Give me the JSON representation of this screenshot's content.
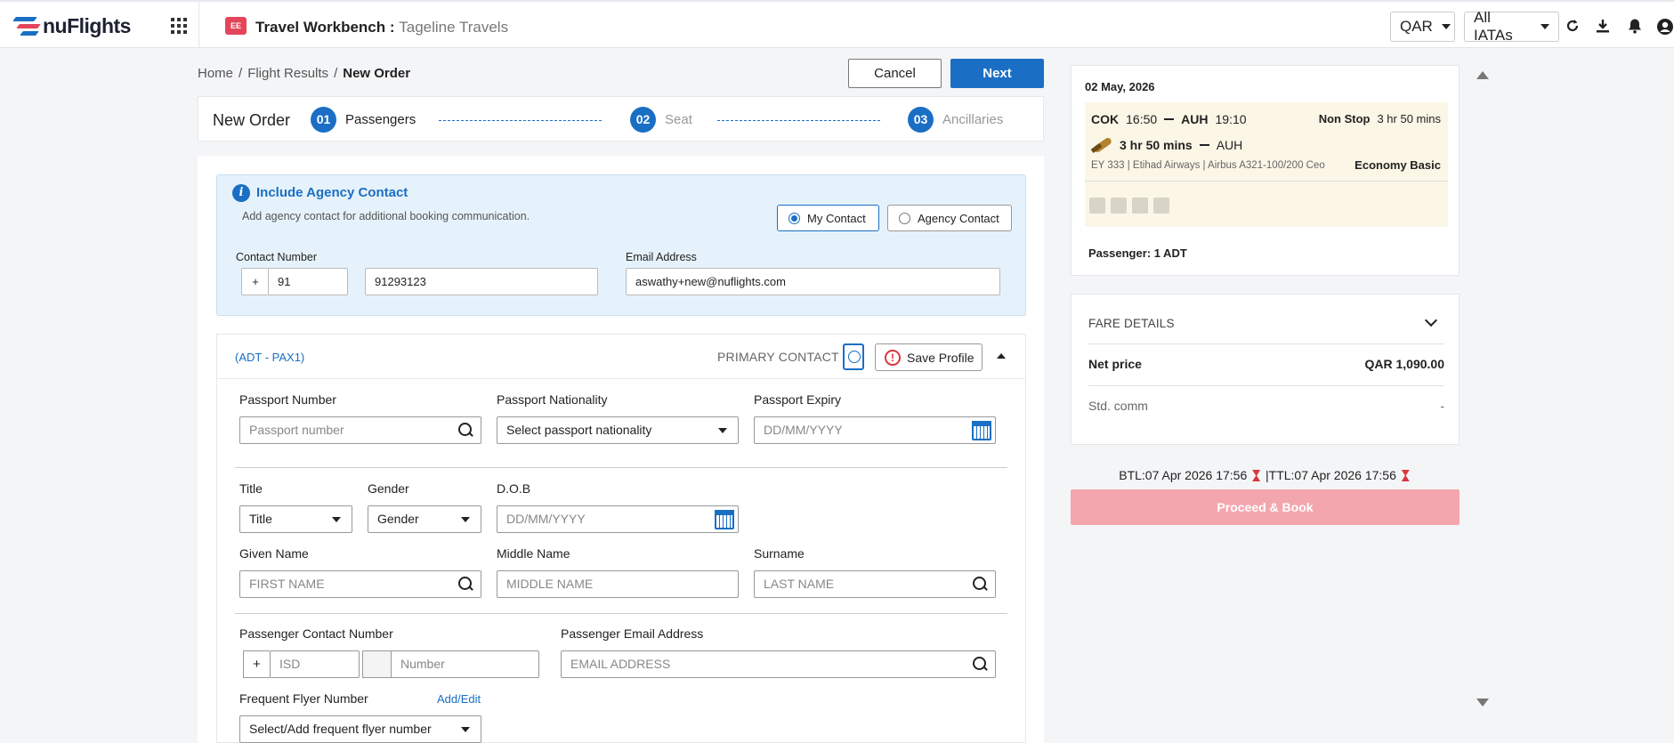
{
  "header": {
    "logo_text": "nuFlights",
    "workbench_icon": "EE",
    "workbench_title": "Travel Workbench : ",
    "agency_name": "Tageline Travels",
    "currency": "QAR",
    "iata": "All IATAs",
    "icons": [
      "apps-grid-icon",
      "refresh-icon",
      "download-icon",
      "bell-icon",
      "user-icon"
    ]
  },
  "breadcrumb": {
    "home": "Home",
    "sep": "/",
    "flight_results": "Flight Results",
    "current": "New Order"
  },
  "actions": {
    "cancel": "Cancel",
    "next": "Next"
  },
  "stepper": {
    "label": "New Order",
    "steps": [
      {
        "num": "01",
        "label": "Passengers"
      },
      {
        "num": "02",
        "label": "Seat"
      },
      {
        "num": "03",
        "label": "Ancillaries"
      }
    ]
  },
  "agency": {
    "info_icon": "i",
    "title": "Include Agency Contact",
    "desc": "Add agency contact for additional booking communication.",
    "my_contact": "My Contact",
    "agency_contact": "Agency Contact",
    "contact_label": "Contact Number",
    "plus": "+",
    "country_code": "91",
    "number": "91293123",
    "email_label": "Email Address",
    "email": "aswathy+new@nuflights.com"
  },
  "passenger": {
    "tag": "(ADT - PAX1)",
    "primary": "PRIMARY CONTACT",
    "save_profile": "Save Profile",
    "warn": "!",
    "passport_number_label": "Passport Number",
    "passport_number_ph": "Passport number",
    "nationality_label": "Passport Nationality",
    "nationality_value": "Select passport nationality",
    "expiry_label": "Passport Expiry",
    "expiry_ph": "DD/MM/YYYY",
    "title_label": "Title",
    "title_value": "Title",
    "gender_label": "Gender",
    "gender_value": "Gender",
    "dob_label": "D.O.B",
    "dob_ph": "DD/MM/YYYY",
    "given_label": "Given Name",
    "given_ph": "FIRST NAME",
    "middle_label": "Middle Name",
    "middle_ph": "MIDDLE NAME",
    "surname_label": "Surname",
    "surname_ph": "LAST NAME",
    "contact_label": "Passenger Contact Number",
    "plus": "+",
    "isd_ph": "ISD",
    "number_ph": "Number",
    "email_label": "Passenger Email Address",
    "email_ph": "EMAIL ADDRESS",
    "ff_label": "Frequent Flyer Number",
    "ff_addedit": "Add/Edit",
    "ff_value": "Select/Add frequent flyer number"
  },
  "flight": {
    "date": "02 May, 2026",
    "origin": "COK",
    "dep_time": "16:50",
    "dest": "AUH",
    "arr_time": "19:10",
    "stops": "Non Stop",
    "duration": "3 hr 50 mins",
    "duration2": "3 hr 50 mins",
    "dest2": "AUH",
    "details": "EY 333 | Etihad Airways | Airbus A321-100/200 Ceo",
    "cabin": "Economy Basic",
    "amenities": [
      "wifi-icon",
      "seat-icon",
      "meal-icon",
      "baggage-icon"
    ],
    "passengers": "Passenger: 1 ADT"
  },
  "fare": {
    "title": "FARE DETAILS",
    "net_label": "Net price",
    "net_value": "QAR 1,090.00",
    "comm_label": "Std. comm",
    "comm_value": "-"
  },
  "deadline": {
    "btl": "BTL:07 Apr 2026 17:56",
    "ttl": "|TTL:07 Apr 2026 17:56"
  },
  "proceed": "Proceed & Book",
  "colors": {
    "primary": "#1a6fc4",
    "proceed_disabled": "#f4a6ae",
    "segment_bg": "#fbf6e6",
    "agency_bg": "#e6f2fb"
  }
}
